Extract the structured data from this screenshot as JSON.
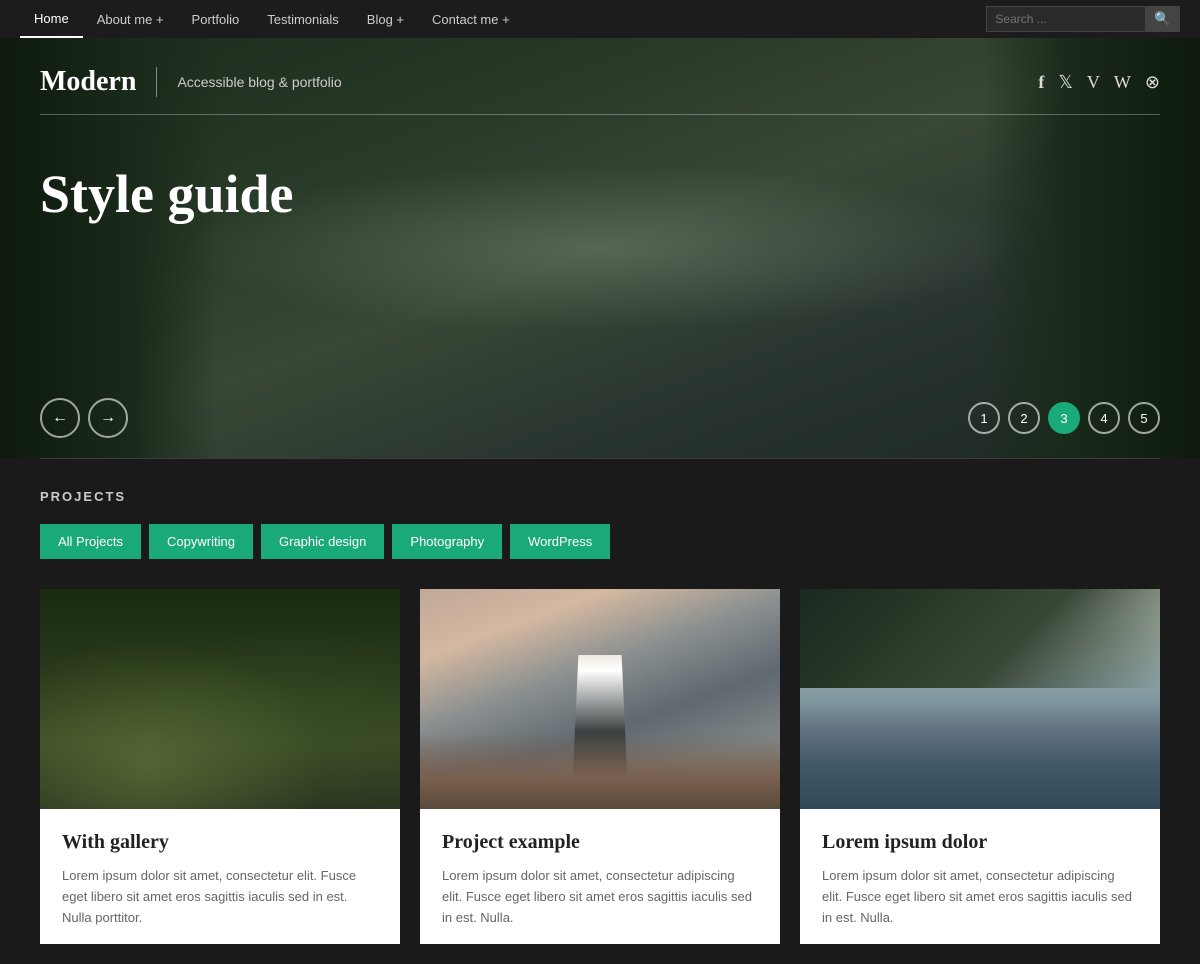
{
  "nav": {
    "items": [
      {
        "label": "Home",
        "active": true
      },
      {
        "label": "About me +",
        "active": false
      },
      {
        "label": "Portfolio",
        "active": false
      },
      {
        "label": "Testimonials",
        "active": false
      },
      {
        "label": "Blog +",
        "active": false
      },
      {
        "label": "Contact me +",
        "active": false
      }
    ],
    "search_placeholder": "Search ..."
  },
  "hero": {
    "brand_name": "Modern",
    "brand_tagline": "Accessible blog & portfolio",
    "social_icons": [
      "f",
      "t",
      "v",
      "w",
      "∞"
    ],
    "title": "Style guide",
    "arrows": {
      "prev": "←",
      "next": "→"
    },
    "pages": [
      "1",
      "2",
      "3",
      "4",
      "5"
    ],
    "active_page": 3
  },
  "projects": {
    "section_title": "PROJECTS",
    "filters": [
      {
        "label": "All Projects"
      },
      {
        "label": "Copywriting"
      },
      {
        "label": "Graphic design"
      },
      {
        "label": "Photography"
      },
      {
        "label": "WordPress"
      }
    ],
    "cards": [
      {
        "title": "With gallery",
        "text": "Lorem ipsum dolor sit amet, consectetur elit. Fusce eget libero sit amet eros sagittis iaculis sed in est. Nulla porttitor."
      },
      {
        "title": "Project example",
        "text": "Lorem ipsum dolor sit amet, consectetur adipiscing elit. Fusce eget libero sit amet eros sagittis iaculis sed in est. Nulla."
      },
      {
        "title": "Lorem ipsum dolor",
        "text": "Lorem ipsum dolor sit amet, consectetur adipiscing elit. Fusce eget libero sit amet eros sagittis iaculis sed in est. Nulla."
      }
    ]
  }
}
